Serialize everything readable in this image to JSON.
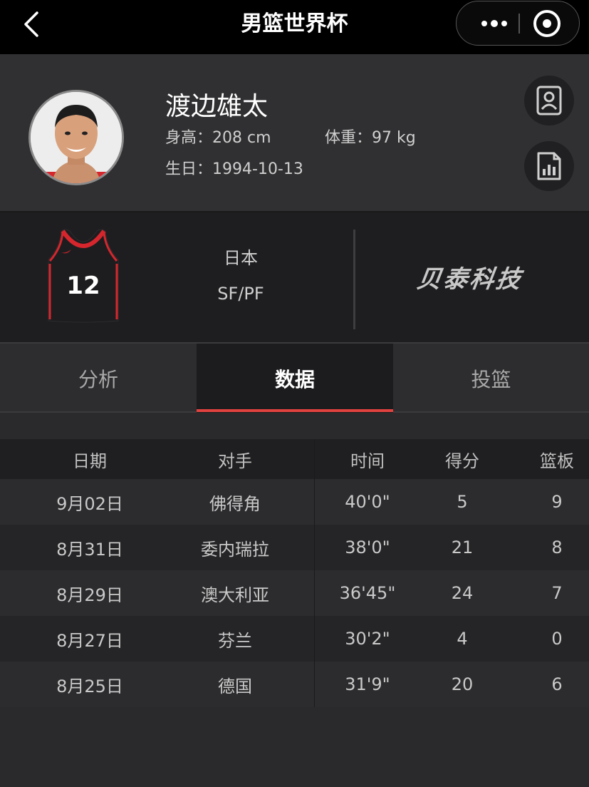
{
  "nav": {
    "title": "男篮世界杯",
    "back_icon": "chevron-left-icon",
    "more_icon": "more-dots-icon",
    "close_icon": "target-close-icon"
  },
  "player": {
    "name": "渡边雄太",
    "height_label": "身高：",
    "height_value": "208 cm",
    "weight_label": "体重：",
    "weight_value": "97 kg",
    "birth_label": "生日：",
    "birth_value": "1994-10-13",
    "profile_icon": "person-card-icon",
    "stats_icon": "bar-chart-doc-icon"
  },
  "team": {
    "jersey_number": "12",
    "country": "日本",
    "position": "SF/PF",
    "sponsor": "贝泰科技"
  },
  "tabs": [
    {
      "label": "分析",
      "active": false
    },
    {
      "label": "数据",
      "active": true
    },
    {
      "label": "投篮",
      "active": false
    }
  ],
  "table": {
    "headers": [
      "日期",
      "对手",
      "时间",
      "得分",
      "篮板"
    ],
    "rows": [
      [
        "9月02日",
        "佛得角",
        "40'0\"",
        "5",
        "9"
      ],
      [
        "8月31日",
        "委内瑞拉",
        "38'0\"",
        "21",
        "8"
      ],
      [
        "8月29日",
        "澳大利亚",
        "36'45\"",
        "24",
        "7"
      ],
      [
        "8月27日",
        "芬兰",
        "30'2\"",
        "4",
        "0"
      ],
      [
        "8月25日",
        "德国",
        "31'9\"",
        "20",
        "6"
      ]
    ]
  },
  "colors": {
    "accent": "#e2423f",
    "background": "#2a2a2c",
    "navbar": "#000000",
    "jersey_trim": "#d6262d"
  }
}
